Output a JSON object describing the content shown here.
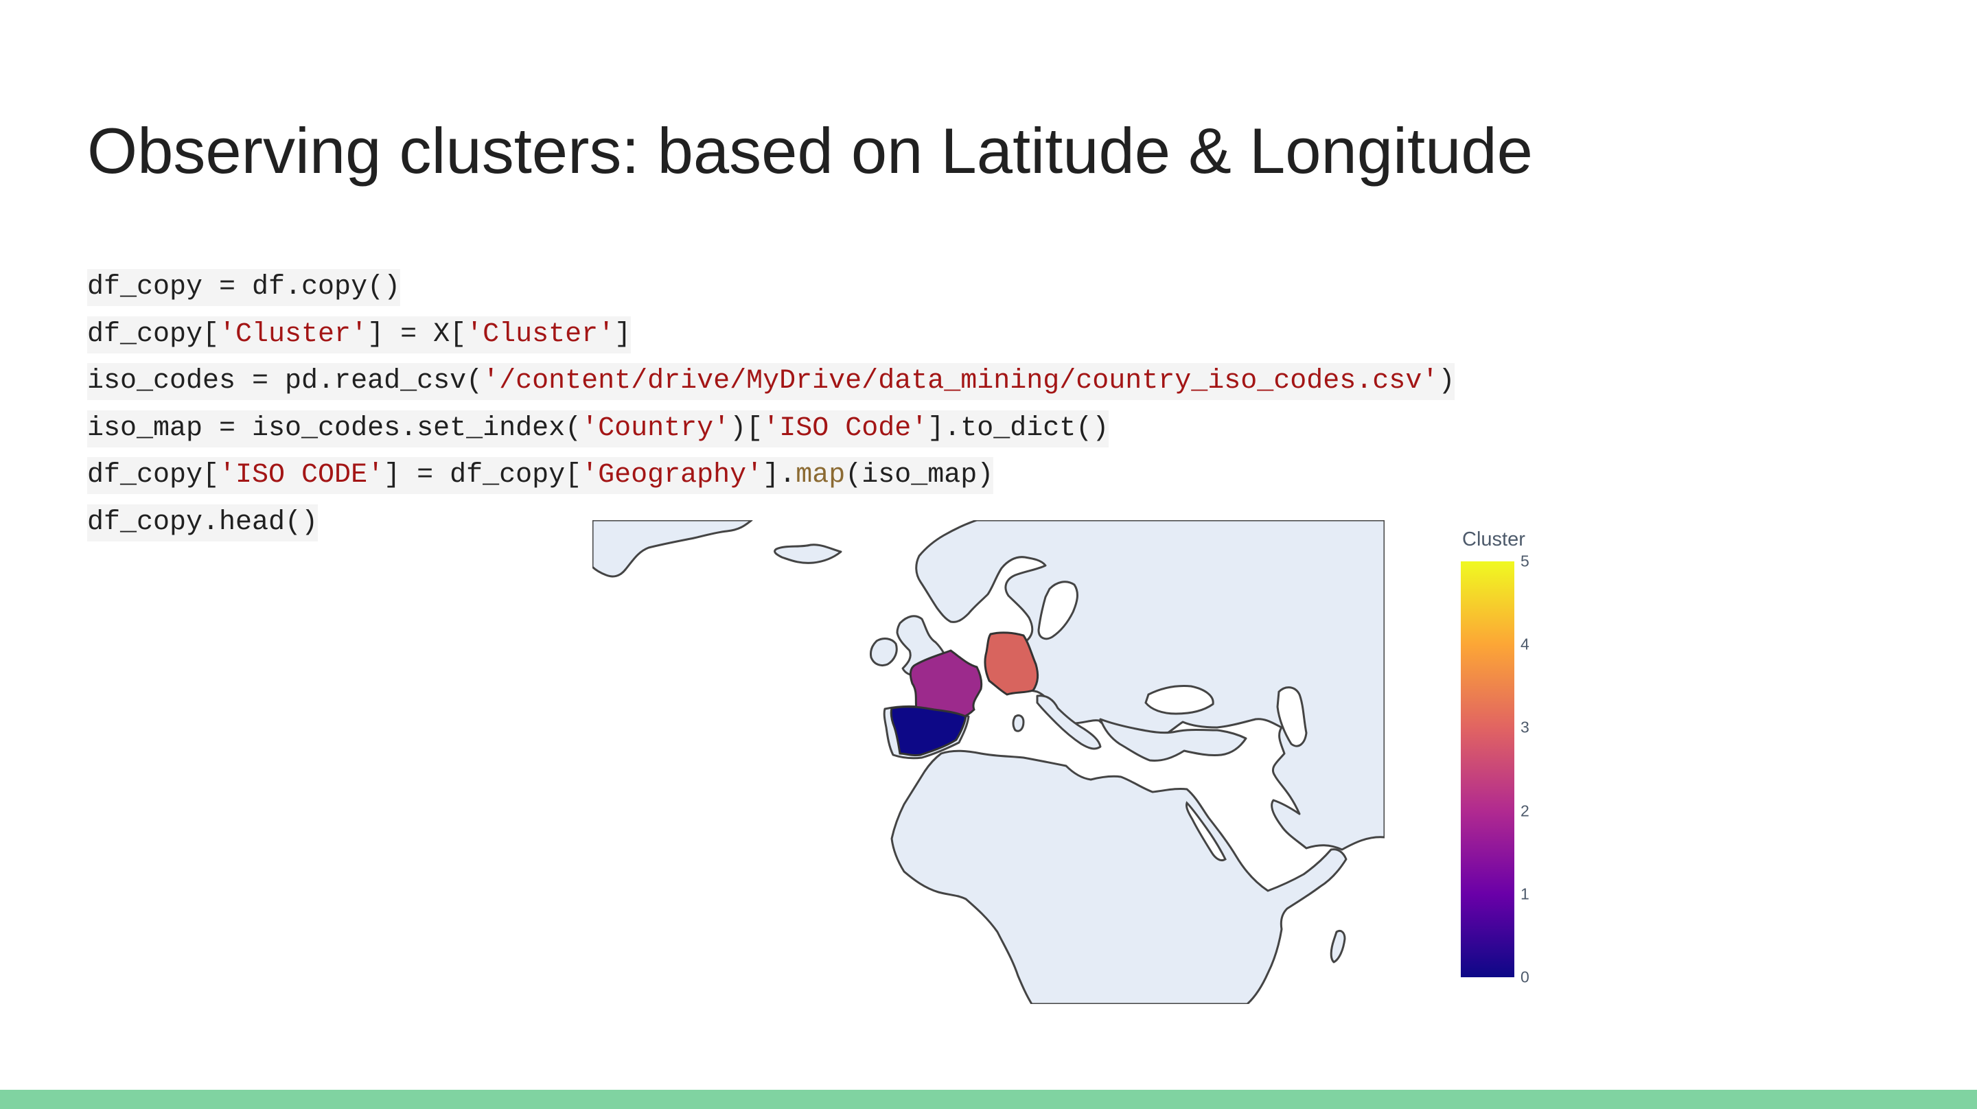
{
  "slide": {
    "title": "Observing clusters: based on Latitude & Longitude"
  },
  "code": {
    "line1": {
      "text": "df_copy = df.copy()"
    },
    "line2": {
      "a": "df_copy[",
      "b": "'Cluster'",
      "c": "] = X[",
      "d": "'Cluster'",
      "e": "]"
    },
    "line3": {
      "a": "iso_codes = pd.read_csv(",
      "b": "'/content/drive/MyDrive/data_mining/country_iso_codes.csv'",
      "c": ")"
    },
    "line4": {
      "a": "iso_map = iso_codes.set_index(",
      "b": "'Country'",
      "c": ")[",
      "d": "'ISO Code'",
      "e": "].to_dict()"
    },
    "line5": {
      "a": "df_copy[",
      "b": "'ISO CODE'",
      "c": "] = df_copy[",
      "d": "'Geography'",
      "e": "].",
      "f": "map",
      "g": "(iso_map)"
    },
    "line6": {
      "text": "df_copy.head()"
    }
  },
  "map": {
    "land_color": "#e5ecf6",
    "border_color": "#444444",
    "countries": [
      {
        "name": "Spain",
        "cluster": 0,
        "color": "#0d0887"
      },
      {
        "name": "France",
        "cluster": 2,
        "color": "#9c2a8c"
      },
      {
        "name": "Germany",
        "cluster": 3,
        "color": "#d8645e"
      }
    ]
  },
  "colorbar": {
    "title": "Cluster",
    "min": 0,
    "max": 5,
    "ticks": [
      "0",
      "1",
      "2",
      "3",
      "4",
      "5"
    ]
  },
  "colors": {
    "accent_bar": "#80d3a1",
    "string_literal": "#a31515",
    "function_name": "#8b6a32"
  }
}
